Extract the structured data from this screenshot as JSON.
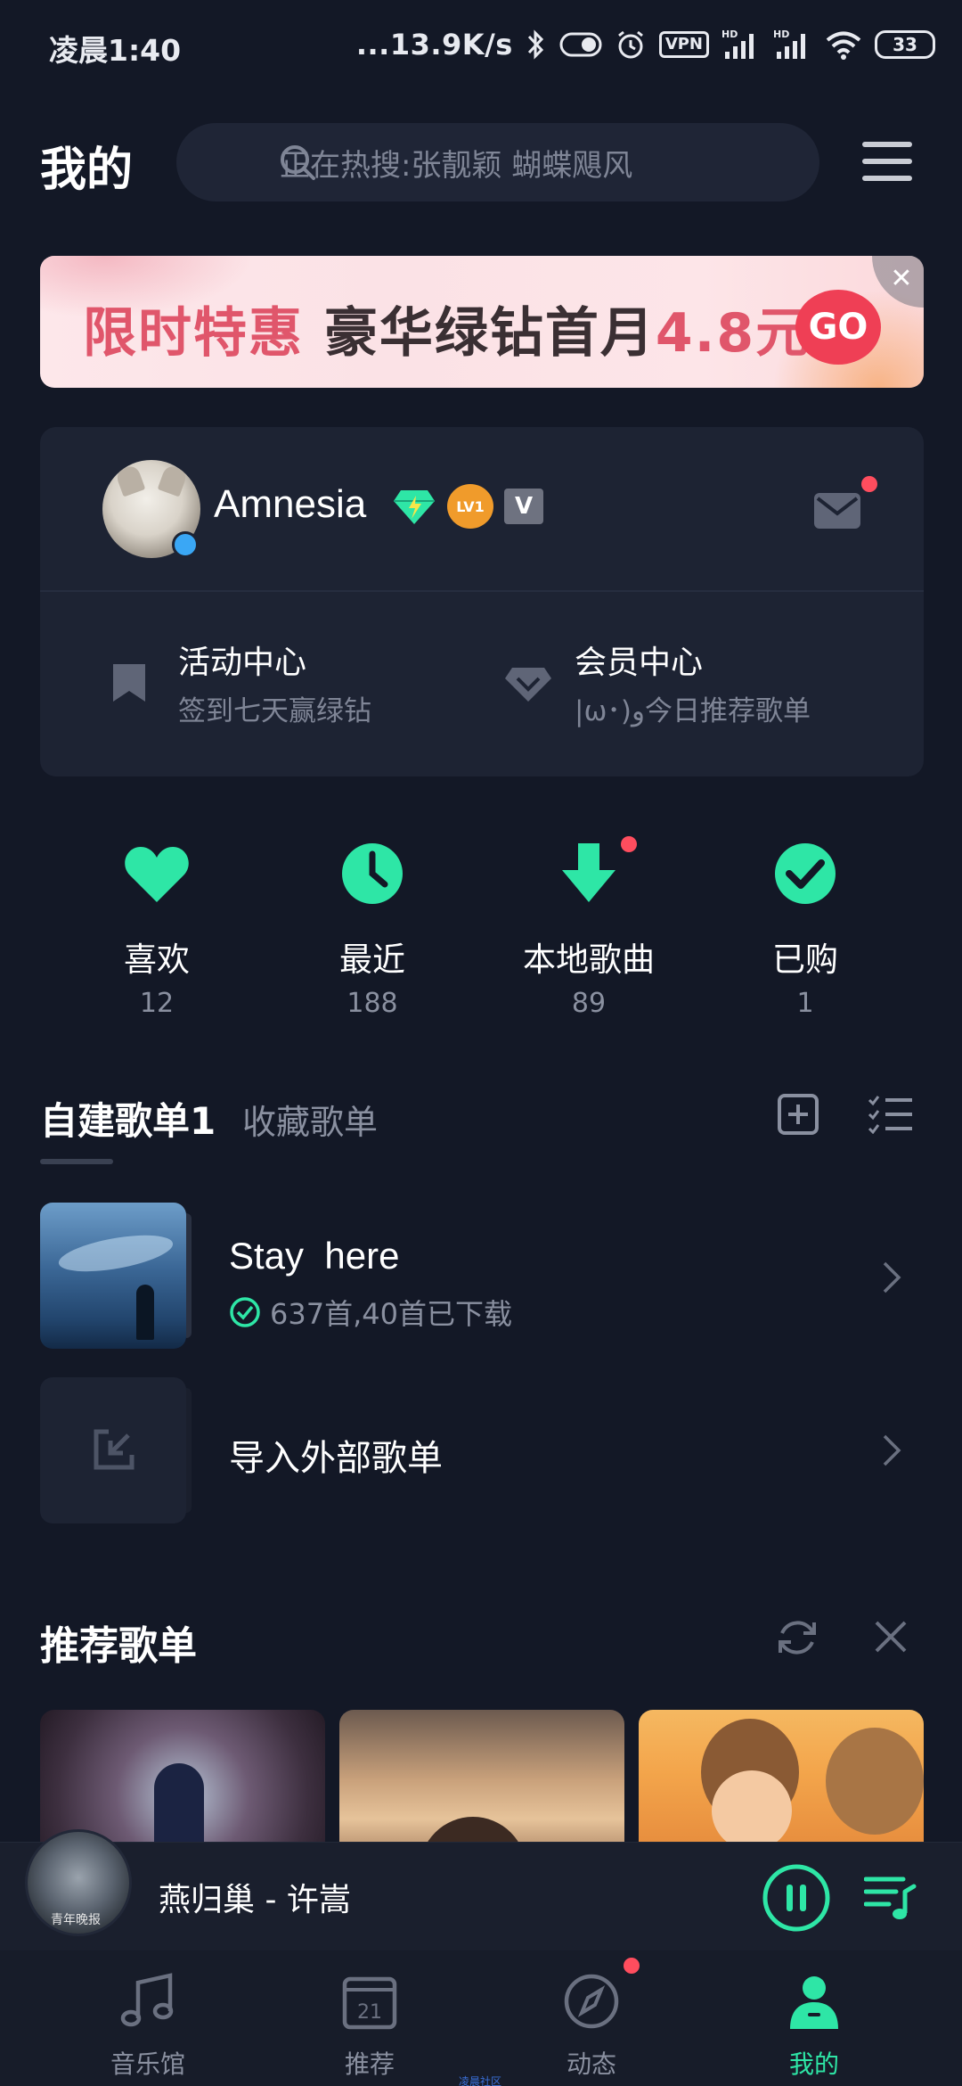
{
  "status_bar": {
    "time": "凌晨1:40",
    "net_speed": "...13.9K/s",
    "vpn": "VPN",
    "hd1": "HD",
    "hd2": "HD",
    "battery": "33"
  },
  "header": {
    "title": "我的",
    "search_placeholder": "正在热搜:张靓颖 蝴蝶飓风"
  },
  "banner": {
    "promo_red": "限时特惠",
    "promo_dark": " 豪华绿钻首月",
    "promo_price": "4.8元",
    "go_label": "GO",
    "close_label": "✕"
  },
  "profile": {
    "username": "Amnesia",
    "level_badge": "LV1",
    "v_badge": "V",
    "activity": {
      "title": "活动中心",
      "subtitle": "签到七天赢绿钻"
    },
    "member": {
      "title": "会员中心",
      "subtitle": "|ω･)و今日推荐歌单"
    }
  },
  "stats": [
    {
      "label": "喜欢",
      "count": "12",
      "icon": "heart-icon"
    },
    {
      "label": "最近",
      "count": "188",
      "icon": "clock-icon"
    },
    {
      "label": "本地歌曲",
      "count": "89",
      "icon": "download-icon"
    },
    {
      "label": "已购",
      "count": "1",
      "icon": "check-circle-icon"
    }
  ],
  "playlists": {
    "tab_active": "自建歌单1",
    "tab_inactive": "收藏歌单",
    "items": [
      {
        "name": "Stay  here",
        "meta": "637首,40首已下载"
      }
    ],
    "import_label": "导入外部歌单"
  },
  "recommended": {
    "title": "推荐歌单"
  },
  "player": {
    "now_playing": "燕归巢 - 许嵩",
    "cover_text": "青年晚报"
  },
  "bottom_nav": [
    {
      "label": "音乐馆",
      "icon": "music-note-icon",
      "active": false
    },
    {
      "label": "推荐",
      "icon": "calendar-icon",
      "active": false
    },
    {
      "label": "动态",
      "icon": "compass-icon",
      "active": false
    },
    {
      "label": "我的",
      "icon": "person-icon",
      "active": true
    }
  ],
  "nav_calendar_day": "21",
  "watermark": "凌晨社区",
  "colors": {
    "accent": "#2ee6a6",
    "background": "#131826",
    "card": "#1d2333",
    "badge_red": "#ff4d5e"
  }
}
